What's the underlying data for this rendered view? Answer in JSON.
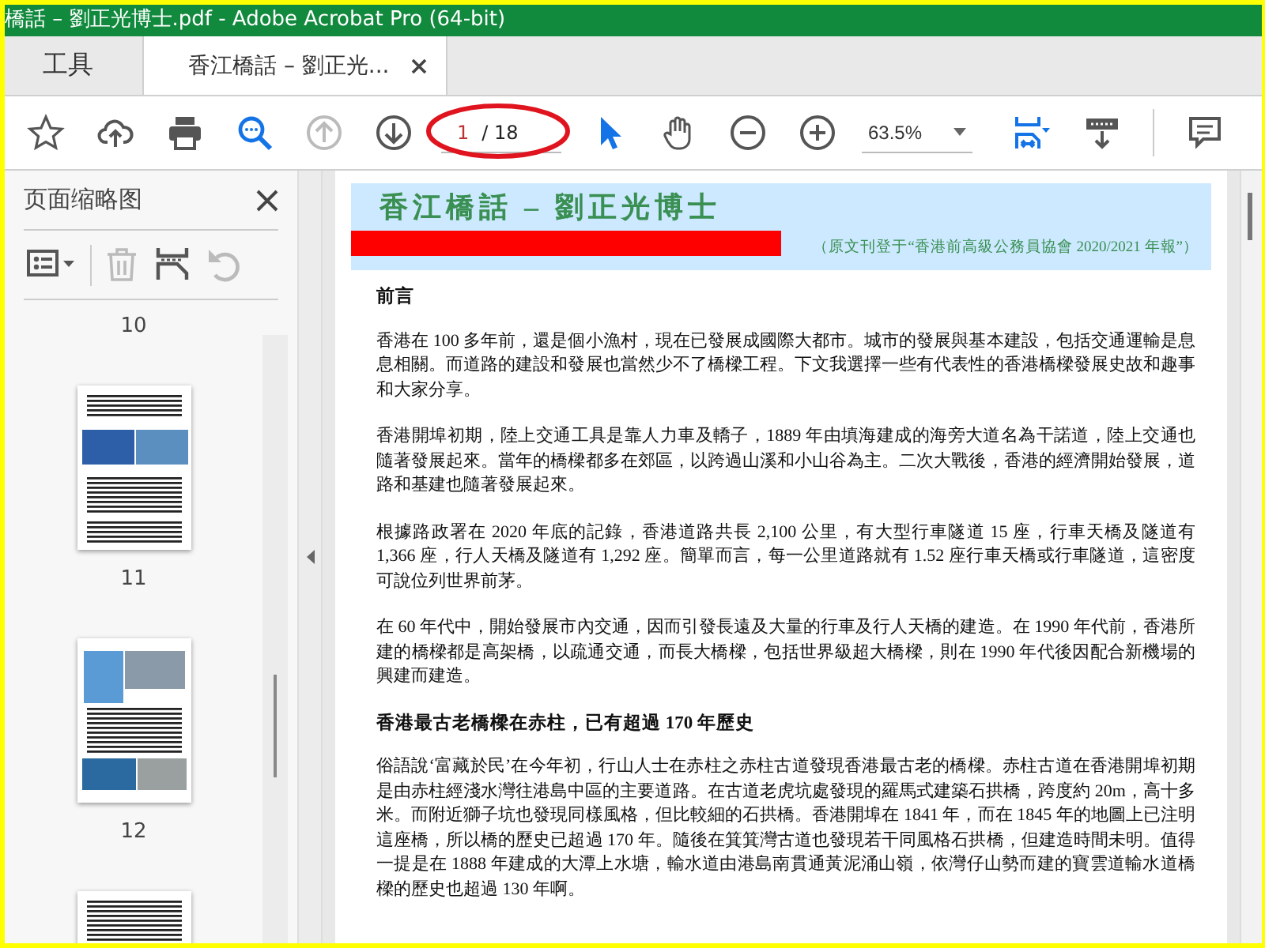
{
  "window": {
    "title": "橋話 – 劉正光博士.pdf - Adobe Acrobat Pro (64-bit)"
  },
  "tabs": [
    {
      "label": "工具",
      "selected": false,
      "closable": false
    },
    {
      "label": "香江橋話 – 劉正光...",
      "selected": true,
      "closable": true
    }
  ],
  "toolbar": {
    "page_current": "1",
    "page_total": "/ 18",
    "page_field_circled": true,
    "zoom": "63.5%",
    "nav_buttons": [
      {
        "kind": "star",
        "disabled": false
      },
      {
        "kind": "upload",
        "disabled": false
      },
      {
        "kind": "print",
        "disabled": false
      },
      {
        "kind": "find",
        "disabled": false
      },
      {
        "kind": "prev",
        "disabled": true
      },
      {
        "kind": "next",
        "disabled": false
      }
    ],
    "view_buttons": [
      {
        "kind": "select",
        "disabled": false
      },
      {
        "kind": "hand",
        "disabled": false
      },
      {
        "kind": "zoomout",
        "disabled": false
      },
      {
        "kind": "zoomin",
        "disabled": false
      }
    ],
    "mode_buttons": [
      {
        "kind": "fit",
        "disabled": false
      },
      {
        "kind": "scroll",
        "disabled": false
      }
    ],
    "end_buttons": [
      {
        "kind": "comment",
        "disabled": false
      }
    ]
  },
  "sidebar": {
    "title": "页面缩略图",
    "tools": [
      {
        "kind": "options",
        "disabled": false
      },
      {
        "kind": "delete",
        "disabled": true
      },
      {
        "kind": "insert",
        "disabled": false
      },
      {
        "kind": "undo",
        "disabled": true
      }
    ],
    "items": [
      {
        "kind": "label",
        "text": "10"
      },
      {
        "kind": "thumbnail"
      },
      {
        "kind": "label",
        "text": "11"
      },
      {
        "kind": "thumbnail"
      },
      {
        "kind": "label",
        "text": "12"
      },
      {
        "kind": "thumbnail"
      }
    ]
  },
  "document": {
    "title": "香江橋話 – 劉正光博士",
    "source": "（原文刊登于“香港前高級公務員協會 2020/2021 年報”）",
    "blocks": [
      {
        "kind": "heading",
        "text": "前言"
      },
      {
        "kind": "paragraph",
        "text": "香港在 100 多年前，還是個小漁村，現在已發展成國際大都市。城市的發展與基本建設，包括交通運輸是息息相關。而道路的建設和發展也當然少不了橋樑工程。下文我選擇一些有代表性的香港橋樑發展史故和趣事和大家分享。"
      },
      {
        "kind": "paragraph",
        "text": "香港開埠初期，陸上交通工具是靠人力車及轎子，1889 年由填海建成的海旁大道名為干諾道，陸上交通也隨著發展起來。當年的橋樑都多在郊區，以跨過山溪和小山谷為主。二次大戰後，香港的經濟開始發展，道路和基建也隨著發展起來。"
      },
      {
        "kind": "paragraph",
        "text": "根據路政署在 2020 年底的記錄，香港道路共長 2,100 公里，有大型行車隧道 15 座，行車天橋及隧道有 1,366 座，行人天橋及隧道有 1,292 座。簡單而言，每一公里道路就有 1.52 座行車天橋或行車隧道，這密度可說位列世界前茅。"
      },
      {
        "kind": "paragraph",
        "text": "在 60 年代中，開始發展市內交通，因而引發長遠及大量的行車及行人天橋的建造。在 1990 年代前，香港所建的橋樑都是高架橋，以疏通交通，而長大橋樑，包括世界級超大橋樑，則在 1990 年代後因配合新機場的興建而建造。"
      },
      {
        "kind": "heading",
        "text": "香港最古老橋樑在赤柱，已有超過 170 年歷史"
      },
      {
        "kind": "paragraph",
        "text": "俗語說‘富藏於民’在今年初，行山人士在赤柱之赤柱古道發現香港最古老的橋樑。赤柱古道在香港開埠初期是由赤柱經淺水灣往港島中區的主要道路。在古道老虎坑處發現的羅馬式建築石拱橋，跨度約 20m，高十多米。而附近獅子坑也發現同樣風格，但比較細的石拱橋。香港開埠在 1841 年，而在 1845 年的地圖上已注明這座橋，所以橋的歷史已超過 170 年。隨後在箕箕灣古道也發現若干同風格石拱橋，但建造時間未明。值得一提是在 1888 年建成的大潭上水塘，輸水道由港島南貫通黃泥涌山嶺，依灣仔山勢而建的寶雲道輸水道橋樑的歷史也超過 130 年啊。"
      }
    ]
  }
}
